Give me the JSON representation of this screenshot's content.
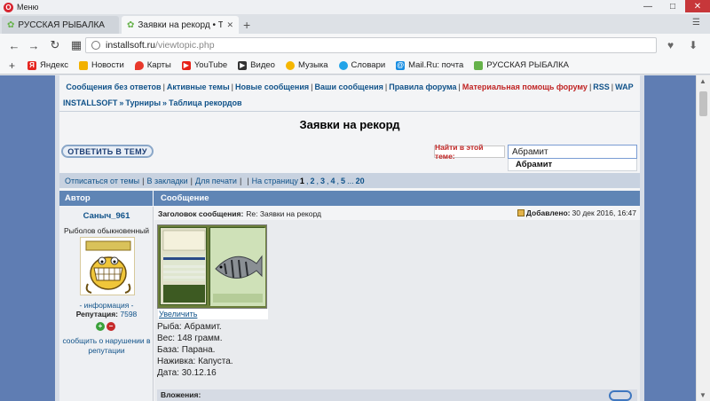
{
  "browser": {
    "menu_label": "Меню",
    "tabs": [
      {
        "title": "РУССКАЯ РЫБАЛКА Install",
        "active": false
      },
      {
        "title": "Заявки на рекорд • Табли",
        "active": true
      }
    ],
    "url_host": "installsoft.ru",
    "url_path": "/viewtopic.php",
    "bookmarks": [
      {
        "label": "Яндекс",
        "icon": "yandex-icon"
      },
      {
        "label": "Новости",
        "icon": "news-icon"
      },
      {
        "label": "Карты",
        "icon": "maps-pin-icon"
      },
      {
        "label": "YouTube",
        "icon": "youtube-icon"
      },
      {
        "label": "Видео",
        "icon": "video-icon"
      },
      {
        "label": "Музыка",
        "icon": "music-icon"
      },
      {
        "label": "Словари",
        "icon": "dictionary-icon"
      },
      {
        "label": "Mail.Ru: почта",
        "icon": "mail-icon"
      },
      {
        "label": "РУССКАЯ РЫБАЛКА",
        "icon": "fish-icon"
      }
    ]
  },
  "forum": {
    "toplinks": {
      "unanswered": "Сообщения без ответов",
      "active": "Активные темы",
      "new": "Новые сообщения",
      "yours": "Ваши сообщения",
      "rules": "Правила форума",
      "donate": "Материальная помощь форуму",
      "rss": "RSS",
      "wap": "WAP"
    },
    "breadcrumbs": {
      "root": "INSTALLSOFT",
      "level1": "Турниры",
      "level2": "Таблица рекордов"
    },
    "topic_title": "Заявки на рекорд",
    "reply_button": "ОТВЕТИТЬ В ТЕМУ",
    "search": {
      "label": "Найти в этой теме:",
      "value": "Абрамит",
      "suggestion": "Абрамит"
    },
    "pager": {
      "unsubscribe": "Отписаться от темы",
      "bookmark": "В закладки",
      "print": "Для печати",
      "to_page": "На страницу",
      "current": "1",
      "pages": [
        "2",
        "3",
        "4",
        "5"
      ],
      "ellipsis": "...",
      "last": "20"
    },
    "table_header": {
      "author": "Автор",
      "message": "Сообщение"
    },
    "post": {
      "author": "Саныч_961",
      "rank": "Рыболов обыкновенный",
      "info_link": "- информация -",
      "reputation_label": "Репутация:",
      "reputation_value": "7598",
      "report_link": "сообщить о нарушении в репутации",
      "subject_label": "Заголовок сообщения:",
      "subject": "Re: Заявки на рекорд",
      "date_label": "Добавлено:",
      "date": "30 дек 2016, 16:47",
      "zoom_link": "Увеличить",
      "lines": [
        "Рыба: Абрамит.",
        "Вес: 148 грамм.",
        "База: Парана.",
        "Наживка: Капуста.",
        "Дата: 30.12.16"
      ],
      "attachments_label": "Вложения:"
    }
  }
}
